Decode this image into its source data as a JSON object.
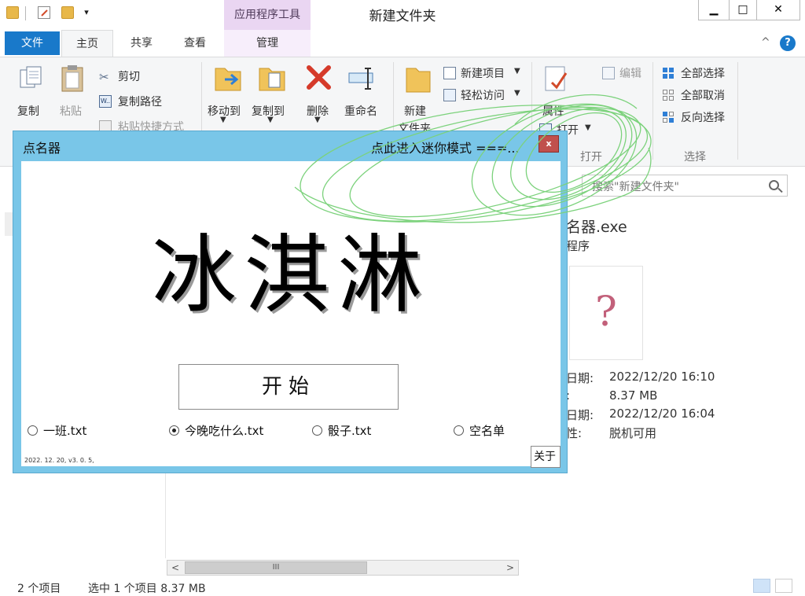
{
  "window": {
    "title": "新建文件夹",
    "minimize_label": "▁",
    "maximize_label": "□",
    "close_label": "✕"
  },
  "context_tab_group": "应用程序工具",
  "ribbon_tabs": {
    "file": "文件",
    "home": "主页",
    "share": "共享",
    "view": "查看",
    "manage": "管理"
  },
  "ribbon": {
    "clipboard": {
      "copy": "复制",
      "paste": "粘贴",
      "cut": "剪切",
      "copy_path": "复制路径",
      "paste_shortcut": "粘贴快捷方式"
    },
    "organize": {
      "move_to": "移动到",
      "copy_to": "复制到",
      "delete": "删除",
      "rename": "重命名"
    },
    "new": {
      "new_folder_line1": "新建",
      "new_folder_line2": "文件夹",
      "new_item": "新建项目",
      "easy_access": "轻松访问"
    },
    "open": {
      "properties": "属性",
      "open": "打开",
      "edit": "编辑",
      "group_label": "打开"
    },
    "select": {
      "select_all": "全部选择",
      "select_none": "全部取消",
      "invert": "反向选择",
      "group_label": "选择"
    }
  },
  "search": {
    "placeholder": "搜索\"新建文件夹\""
  },
  "details": {
    "filename_partial": "名器.exe",
    "type_partial": "程序",
    "rows": [
      {
        "label": "日期:",
        "value": "2022/12/20 16:10"
      },
      {
        "label": ":",
        "value": "8.37 MB"
      },
      {
        "label": "日期:",
        "value": "2022/12/20 16:04"
      },
      {
        "label": "性:",
        "value": "脱机可用"
      }
    ],
    "thumb_glyph": "?"
  },
  "scrollbar": {
    "left": "<",
    "right": ">",
    "grip": "III"
  },
  "status": {
    "items": "2 个项目",
    "selected": "选中 1 个项目 8.37 MB"
  },
  "dialog": {
    "title": "点名器",
    "mini_mode": "点此进入迷你模式 ===...",
    "close": "x",
    "name": "冰淇淋",
    "start": "开始",
    "lists": [
      {
        "label": "一班.txt",
        "selected": false
      },
      {
        "label": "今晚吃什么.txt",
        "selected": true
      },
      {
        "label": "骰子.txt",
        "selected": false
      },
      {
        "label": "空名单",
        "selected": false
      }
    ],
    "version": "2022. 12. 20, v3. 0. 5,",
    "about": "关于"
  },
  "colors": {
    "file_tab": "#1979ca",
    "dialog_frame": "#79c6e8",
    "dialog_close": "#c0504d",
    "scribble": "#7cd27c"
  }
}
